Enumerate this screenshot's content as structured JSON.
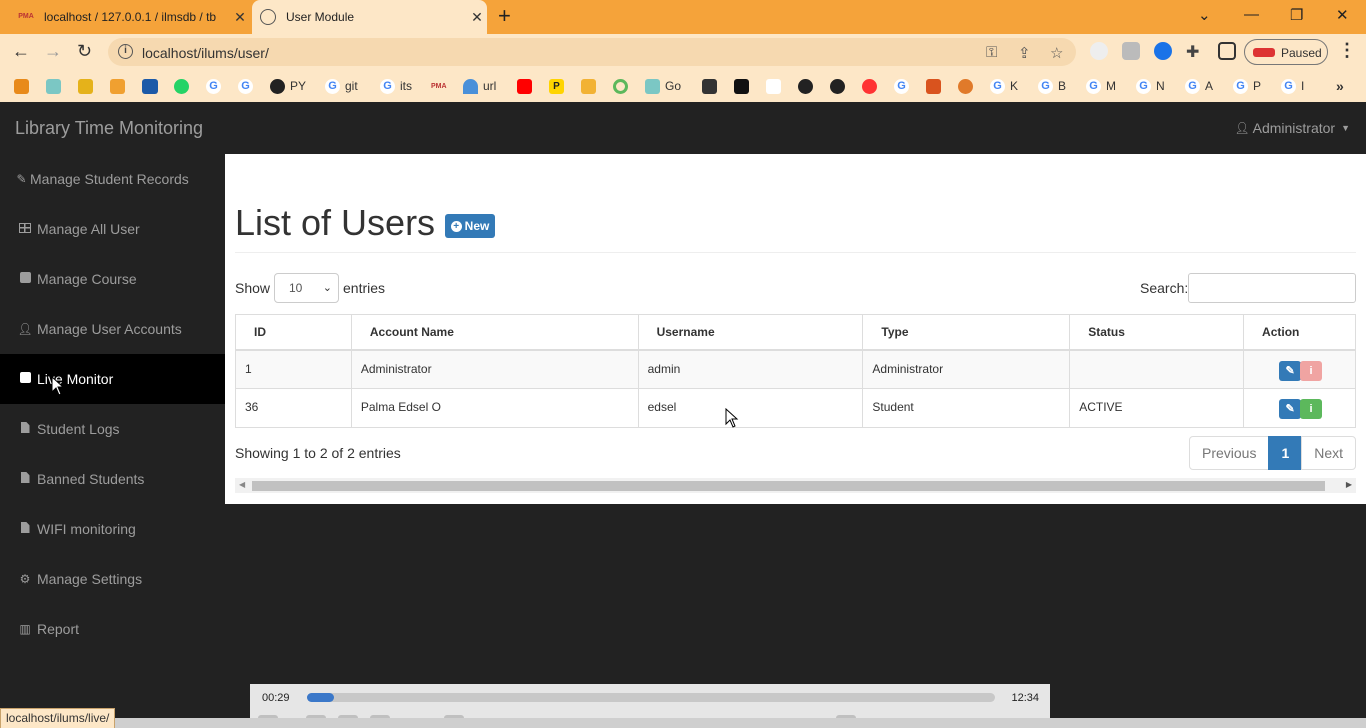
{
  "browser": {
    "tabs": [
      {
        "title": "localhost / 127.0.0.1 / ilmsdb / tb",
        "favicon": "PMA",
        "active": false
      },
      {
        "title": "User Module",
        "favicon": "globe",
        "active": true
      }
    ],
    "url": "localhost/ilums/user/",
    "paused_label": "Paused",
    "bookmarks": [
      "PY",
      "git",
      "its",
      "url",
      "Go",
      "K",
      "B",
      "M",
      "N",
      "A",
      "P",
      "I"
    ],
    "status_url": "localhost/ilums/live/"
  },
  "app": {
    "brand": "Library Time Monitoring",
    "user_menu": "Administrator",
    "sidebar": [
      {
        "label": "Manage Student Records",
        "icon": "pencil-icon"
      },
      {
        "label": "Manage All User",
        "icon": "table-icon"
      },
      {
        "label": "Manage Course",
        "icon": "book-icon"
      },
      {
        "label": "Manage User Accounts",
        "icon": "user-icon"
      },
      {
        "label": "Live Monitor",
        "icon": "square-icon",
        "active": true
      },
      {
        "label": "Student Logs",
        "icon": "file-icon"
      },
      {
        "label": "Banned Students",
        "icon": "file-icon"
      },
      {
        "label": "WIFI monitoring",
        "icon": "file-icon"
      },
      {
        "label": "Manage Settings",
        "icon": "gear-icon"
      },
      {
        "label": "Report",
        "icon": "bar-chart-icon"
      }
    ]
  },
  "page": {
    "title": "List of Users",
    "new_button": "New",
    "show_label": "Show",
    "length_value": "10",
    "entries_label": "entries",
    "search_label": "Search:",
    "search_value": "",
    "columns": [
      "ID",
      "Account Name",
      "Username",
      "Type",
      "Status",
      "Action"
    ],
    "rows": [
      {
        "id": "1",
        "account_name": "Administrator",
        "username": "admin",
        "type": "Administrator",
        "status": ""
      },
      {
        "id": "36",
        "account_name": "Palma Edsel O",
        "username": "edsel",
        "type": "Student",
        "status": "ACTIVE"
      }
    ],
    "info": "Showing 1 to 2 of 2 entries",
    "pager": {
      "previous": "Previous",
      "current": "1",
      "next": "Next"
    }
  },
  "video": {
    "elapsed": "00:29",
    "total": "12:34",
    "progress": 0.039
  }
}
